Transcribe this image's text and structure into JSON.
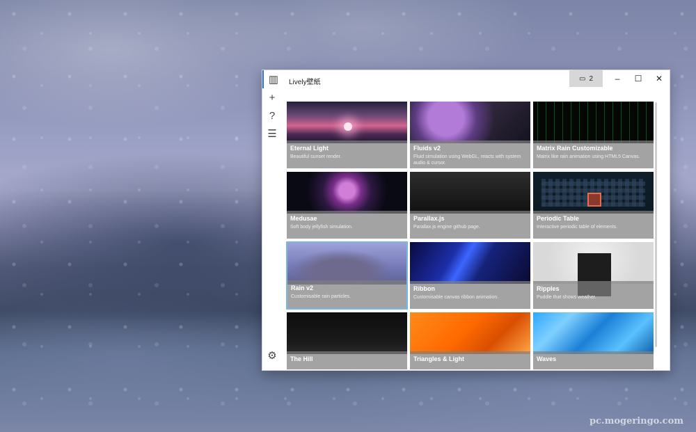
{
  "window": {
    "title": "Lively壁紙",
    "monitor_count": "2",
    "caption": {
      "minimize": "–",
      "maximize": "☐",
      "close": "✕"
    }
  },
  "rail": {
    "icons": [
      "library-icon",
      "add-icon",
      "help-icon",
      "feedback-icon"
    ],
    "settings": "settings-icon"
  },
  "tiles": [
    {
      "title": "Eternal Light",
      "desc": "Beautiful sunset render."
    },
    {
      "title": "Fluids v2",
      "desc": "Fluid simulation using WebGL, reacts with system audio & cursor."
    },
    {
      "title": "Matrix Rain Customizable",
      "desc": "Matrix like rain animation using HTML5 Canvas."
    },
    {
      "title": "Medusae",
      "desc": "Soft body jellyfish simulation."
    },
    {
      "title": "Parallax.js",
      "desc": "Parallax.js engine github page."
    },
    {
      "title": "Periodic Table",
      "desc": "Interactive periodic table of elements."
    },
    {
      "title": "Rain v2",
      "desc": "Customisable rain particles."
    },
    {
      "title": "Ribbon",
      "desc": "Customisable canvas ribbon animation."
    },
    {
      "title": "Ripples",
      "desc": "Puddle that shows weather."
    },
    {
      "title": "The Hill",
      "desc": ""
    },
    {
      "title": "Triangles & Light",
      "desc": ""
    },
    {
      "title": "Waves",
      "desc": ""
    }
  ],
  "watermark": "pc.mogeringo.com"
}
